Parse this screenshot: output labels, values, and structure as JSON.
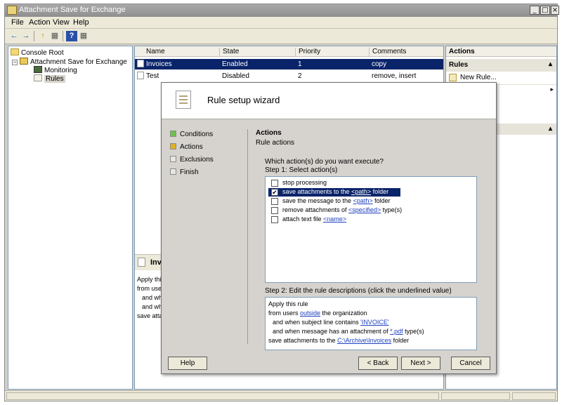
{
  "window": {
    "title": "Attachment Save for Exchange",
    "minimize": "_",
    "maximize": "□",
    "close": "×"
  },
  "menu": [
    "File",
    "Action",
    "View",
    "Help"
  ],
  "toolbar": {
    "back": "←",
    "forward": "→",
    "up": "↑",
    "show_tree": "▦",
    "help": "?",
    "show_pane": "▦"
  },
  "tree": {
    "root": "Console Root",
    "app": "Attachment Save for Exchange",
    "monitoring": "Monitoring",
    "rules": "Rules",
    "expander": "−"
  },
  "list": {
    "columns": [
      "Name",
      "State",
      "Priority",
      "Comments"
    ],
    "rows": [
      {
        "name": "Invoices",
        "state": "Enabled",
        "priority": "1",
        "comments": "copy"
      },
      {
        "name": "Test",
        "state": "Disabled",
        "priority": "2",
        "comments": "remove, insert"
      }
    ]
  },
  "detail": {
    "title": "Invo",
    "lines": [
      "Apply this r",
      "from users",
      "and whe",
      "and whe",
      "save attach"
    ]
  },
  "actions_pane": {
    "header": "Actions",
    "section": "Rules",
    "new_rule": "New Rule...",
    "chevron": "▴",
    "more": "▸"
  },
  "wizard": {
    "title": "Rule setup wizard",
    "steps": [
      {
        "label": "Conditions",
        "color": "#6cc24a"
      },
      {
        "label": "Actions",
        "color": "#e0b020"
      },
      {
        "label": "Exclusions",
        "color": "#e8e6e0"
      },
      {
        "label": "Finish",
        "color": "#e8e6e0"
      }
    ],
    "section_title": "Actions",
    "section_subtitle": "Rule actions",
    "question": "Which action(s) do you want execute?",
    "step1": "Step 1: Select action(s)",
    "step2": "Step 2: Edit the rule descriptions (click the underlined value)",
    "actions": [
      {
        "pre": "stop processing",
        "link": "",
        "post": "",
        "checked": false,
        "selected": false
      },
      {
        "pre": "save attachments to the ",
        "link": "<path>",
        "post": " folder",
        "checked": true,
        "selected": true
      },
      {
        "pre": "save the message to the ",
        "link": "<path>",
        "post": " folder",
        "checked": false,
        "selected": false
      },
      {
        "pre": "remove attachments of ",
        "link": "<specified>",
        "post": " type(s)",
        "checked": false,
        "selected": false
      },
      {
        "pre": "attach text file ",
        "link": "<name>",
        "post": "",
        "checked": false,
        "selected": false
      }
    ],
    "description": [
      {
        "pre": "Apply this rule",
        "link": "",
        "post": ""
      },
      {
        "pre": "from users ",
        "link": "outside",
        "post": " the organization"
      },
      {
        "pre": "   and when subject line contains ",
        "link": "'INVOICE'",
        "post": ""
      },
      {
        "pre": "   and when message has an attachment of ",
        "link": "*.pdf",
        "post": " type(s)"
      },
      {
        "pre": "save attachments to the ",
        "link": "C:\\Archive\\Invoices",
        "post": " folder"
      }
    ],
    "buttons": {
      "help": "Help",
      "back": "< Back",
      "next": "Next >",
      "cancel": "Cancel"
    }
  }
}
